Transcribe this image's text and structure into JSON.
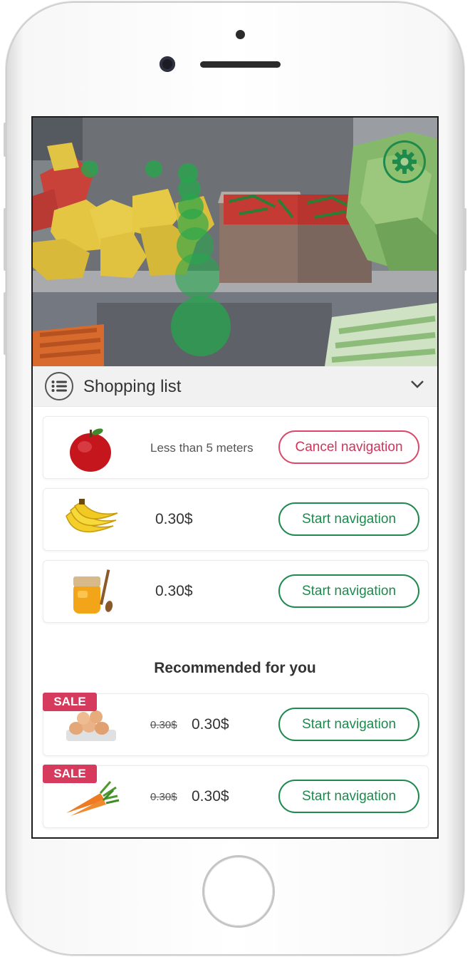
{
  "app": {
    "shopping_list_title": "Shopping list",
    "recommended_title": "Recommended for you",
    "accent_green": "#1f8a4d",
    "accent_red": "#d2335a",
    "sale_color": "#d63b5e"
  },
  "icons": {
    "settings": "gear-icon",
    "list": "list-icon",
    "collapse": "chevron-down-icon"
  },
  "shopping_items": [
    {
      "product": "apple",
      "info": "Less than 5 meters",
      "action": "Cancel navigation"
    },
    {
      "product": "banana",
      "price": "0.30$",
      "action": "Start navigation"
    },
    {
      "product": "honey",
      "price": "0.30$",
      "action": "Start navigation"
    }
  ],
  "recommended_items": [
    {
      "product": "eggs",
      "badge": "SALE",
      "old_price": "0.30$",
      "price": "0.30$",
      "action": "Start navigation"
    },
    {
      "product": "carrots",
      "badge": "SALE",
      "old_price": "0.30$",
      "price": "0.30$",
      "action": "Start navigation"
    }
  ]
}
